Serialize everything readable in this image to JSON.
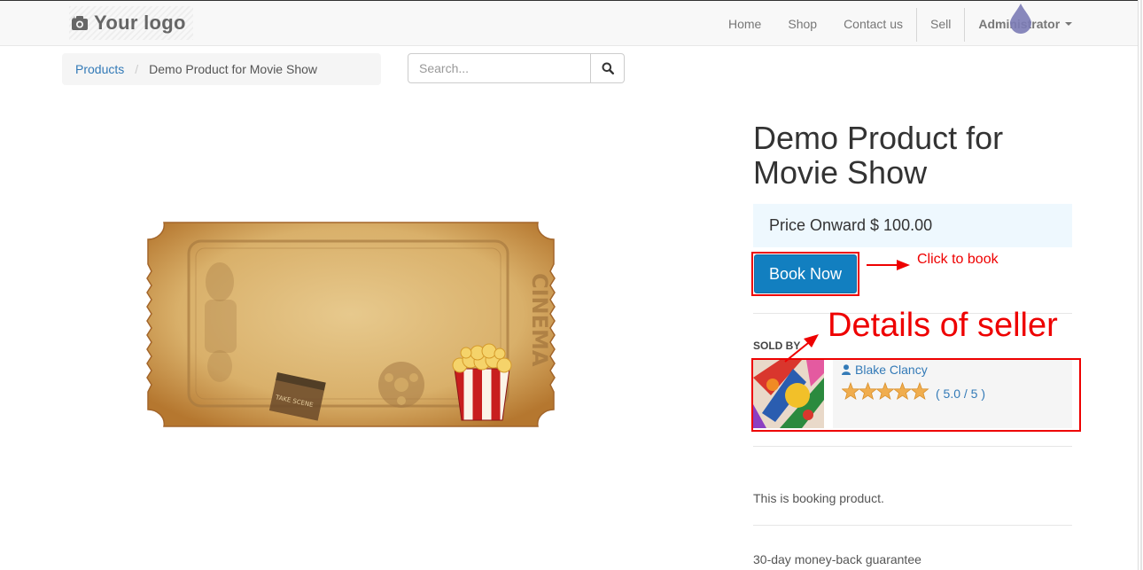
{
  "navbar": {
    "logo_text": "Your logo",
    "items": [
      {
        "label": "Home"
      },
      {
        "label": "Shop"
      },
      {
        "label": "Contact us"
      },
      {
        "label": "Sell"
      }
    ],
    "user_label": "Administrator"
  },
  "breadcrumb": {
    "link": "Products",
    "current": "Demo Product for Movie Show"
  },
  "search": {
    "placeholder": "Search..."
  },
  "product": {
    "title": "Demo Product for Movie Show",
    "price": "Price Onward $ 100.00",
    "book_label": "Book Now",
    "sold_by_label": "SOLD BY",
    "seller_name": "Blake Clancy",
    "rating_value": 5.0,
    "rating_text": "( 5.0 / 5 )",
    "description": "This is booking product.",
    "guarantee": "30-day money-back guarantee"
  },
  "annotations": {
    "book": "Click to book",
    "seller": "Details of seller"
  },
  "ticket": {
    "side_text": "CINEMA",
    "clapper_text": "TAKE SCENE"
  },
  "colors": {
    "link": "#337ab7",
    "button": "#127fc0",
    "price_bg": "#eef8fe",
    "annotation": "#ee0000",
    "star": "#f0ad4e"
  }
}
